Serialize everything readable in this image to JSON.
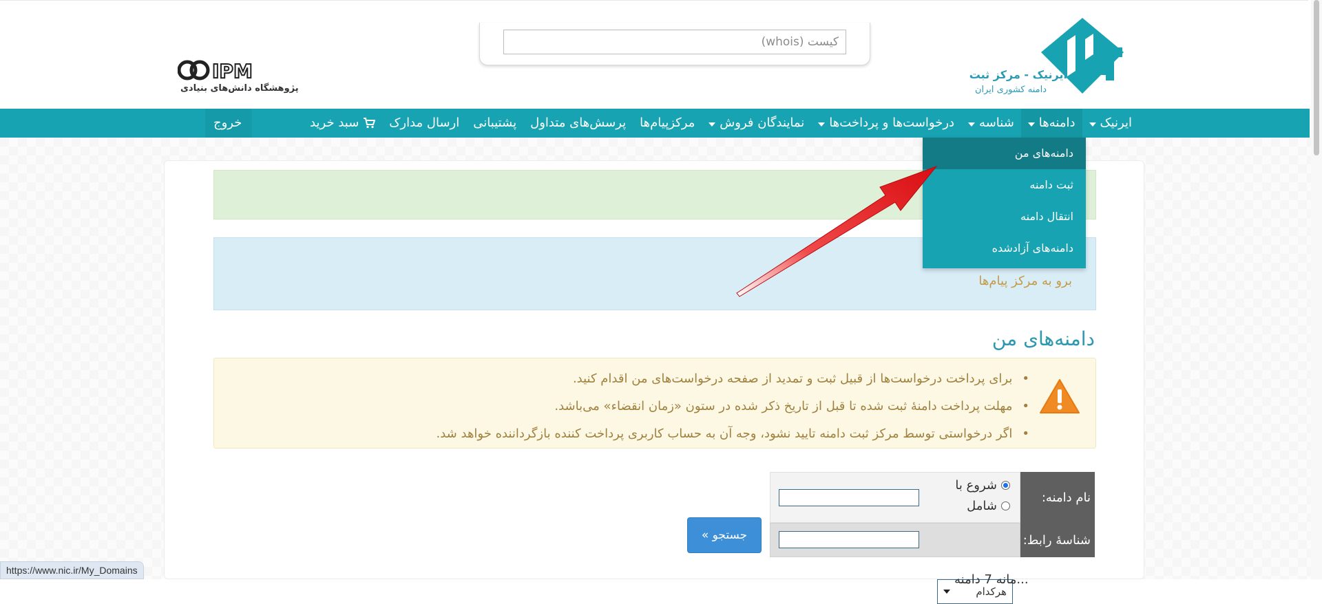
{
  "header": {
    "brand_title": "ایرنیک - مرکز ثبت",
    "brand_subtitle": "دامنه کشوری ایران",
    "partner_logo_text": "IPM",
    "partner_caption": "پژوهشگاه دانش‌های بنیادی",
    "whois_placeholder": "کیست (whois)"
  },
  "nav": {
    "items": [
      {
        "label": "ایرنیک",
        "dropdown": true
      },
      {
        "label": "دامنه‌ها",
        "dropdown": true
      },
      {
        "label": "شناسه",
        "dropdown": true
      },
      {
        "label": "درخواست‌ها و پرداخت‌ها",
        "dropdown": true
      },
      {
        "label": "نمایندگان فروش",
        "dropdown": true
      },
      {
        "label": "مرکزپیام‌ها",
        "dropdown": false
      },
      {
        "label": "پرسش‌های متداول",
        "dropdown": false
      },
      {
        "label": "پشتیبانی",
        "dropdown": false
      },
      {
        "label": "ارسال مدارک",
        "dropdown": false
      },
      {
        "label": "سبد خرید",
        "dropdown": false,
        "icon": "cart-icon"
      }
    ],
    "logout_label": "خروج"
  },
  "dropdown_domains": {
    "items": [
      {
        "label": "دامنه‌های من"
      },
      {
        "label": "ثبت دامنه"
      },
      {
        "label": "انتقال دامنه"
      },
      {
        "label": "دامنه‌های آزادشده"
      }
    ]
  },
  "alerts": {
    "info_link": "برو به مرکز پیام‌ها"
  },
  "page": {
    "title": "دامنه‌های من",
    "notes": [
      "برای پرداخت درخواست‌ها از قبیل ثبت و تمدید از صفحه درخواست‌های من اقدام کنید.",
      "مهلت پرداخت دامنهٔ ثبت شده تا قبل از تاریخ ذکر شده در ستون «زمان انقضاء» می‌باشد.",
      "اگر درخواستی توسط مرکز ثبت دامنه تایید نشود، وجه آن به حساب کاربری پرداخت کننده بازگرداننده خواهد شد."
    ]
  },
  "search": {
    "domain_label": "نام دامنه:",
    "starts_with": "شروع با",
    "contains": "شامل",
    "contact_label": "شناسهٔ رابط:",
    "contact_select_value": "هرکدام",
    "button_label": "جستجو »"
  },
  "partial_text": "...مانه 7 دامنه",
  "status_url": "https://www.nic.ir/My_Domains",
  "colors": {
    "primary": "#17a3b1",
    "accent_title": "#2b98b0",
    "warning_bg": "#fcf8e3",
    "success_bg": "#dff0d8",
    "info_bg": "#d9edf7",
    "button": "#3d8fd8",
    "annotation_arrow": "#e8161b"
  }
}
